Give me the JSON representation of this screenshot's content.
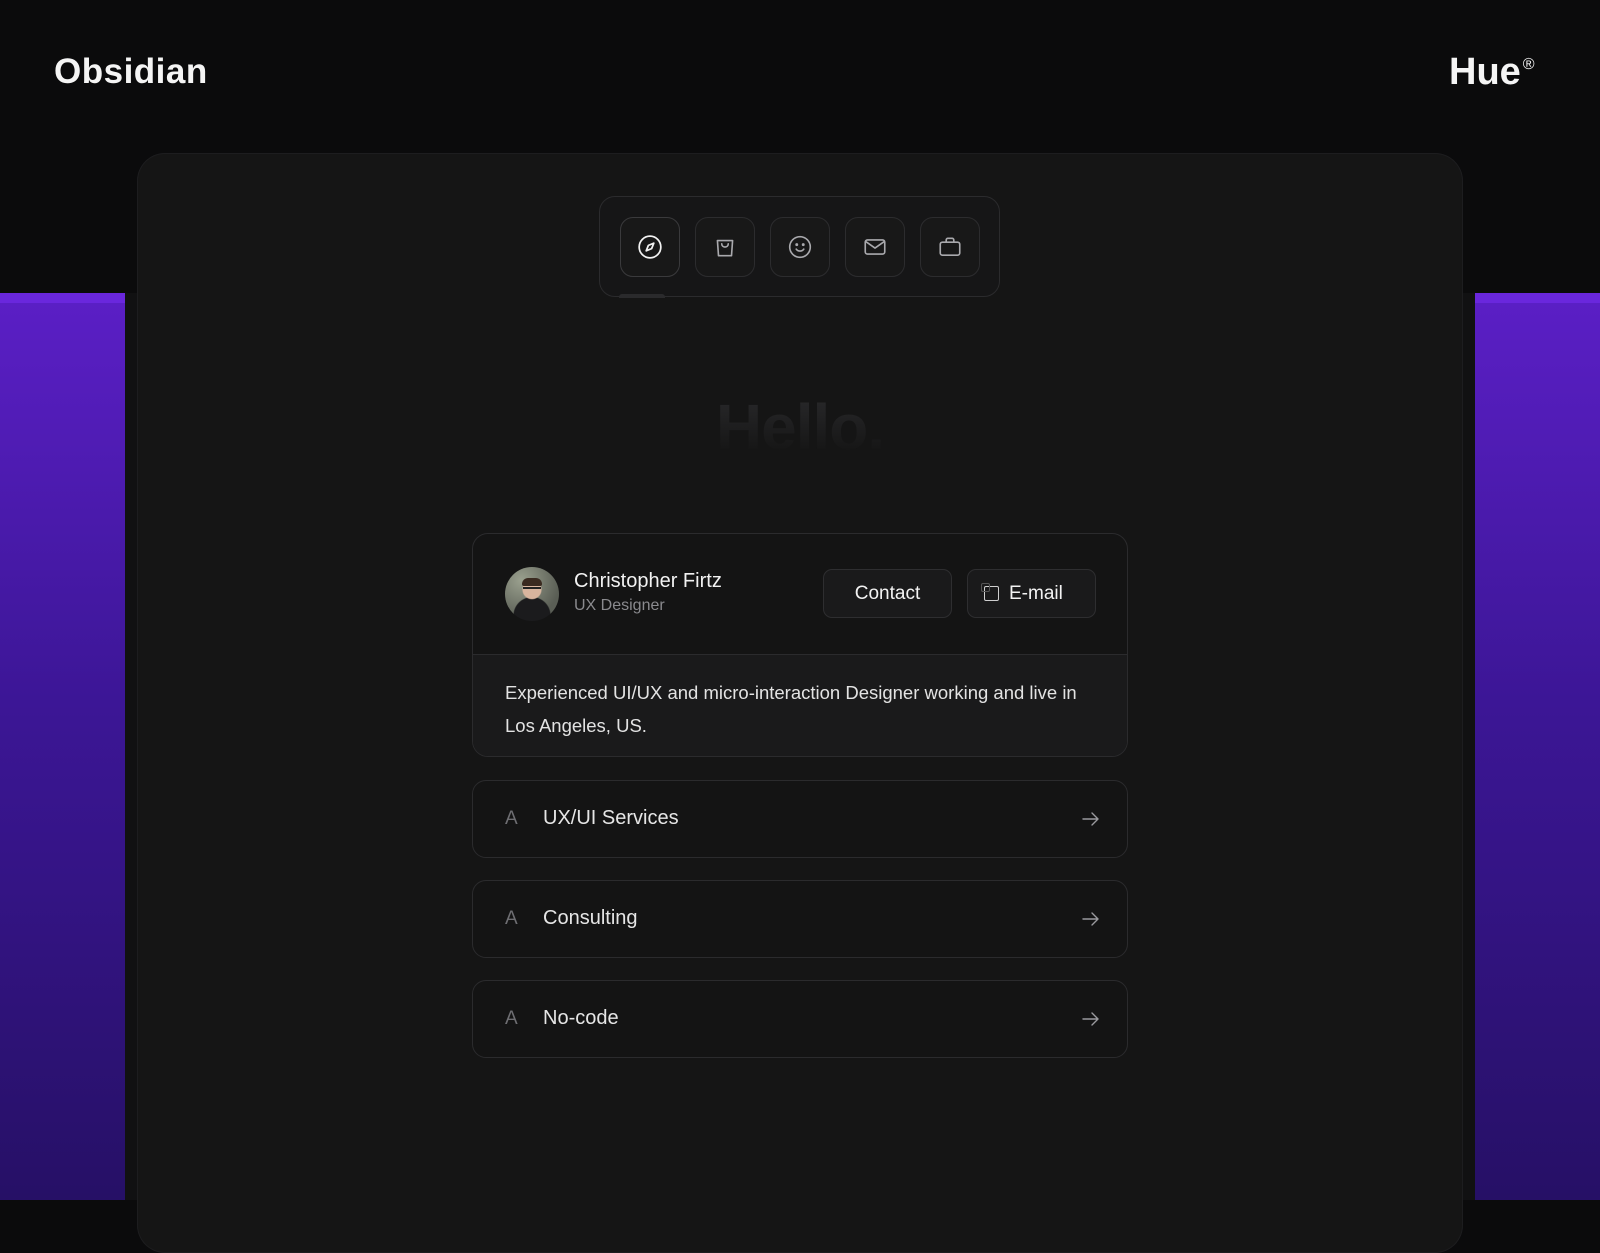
{
  "brand": {
    "left": "Obsidian",
    "right": "Hue",
    "right_mark": "®"
  },
  "colors": {
    "accent_purple": "#5b1fc6",
    "background": "#0b0b0c",
    "card": "#151515"
  },
  "nav": {
    "icons": [
      {
        "name": "compass-icon",
        "active": true
      },
      {
        "name": "shopping-bag-icon",
        "active": false
      },
      {
        "name": "smiley-icon",
        "active": false
      },
      {
        "name": "mail-icon",
        "active": false
      },
      {
        "name": "briefcase-icon",
        "active": false
      }
    ]
  },
  "hero": {
    "title": "Hello."
  },
  "profile": {
    "name": "Christopher Firtz",
    "role": "UX Designer",
    "contact_label": "Contact",
    "email_label": "E-mail",
    "bio": "Experienced UI/UX and micro-interaction Designer working and live in Los Angeles, US."
  },
  "services": [
    {
      "letter": "A",
      "label": "UX/UI Services"
    },
    {
      "letter": "A",
      "label": "Consulting"
    },
    {
      "letter": "A",
      "label": "No-code"
    }
  ]
}
